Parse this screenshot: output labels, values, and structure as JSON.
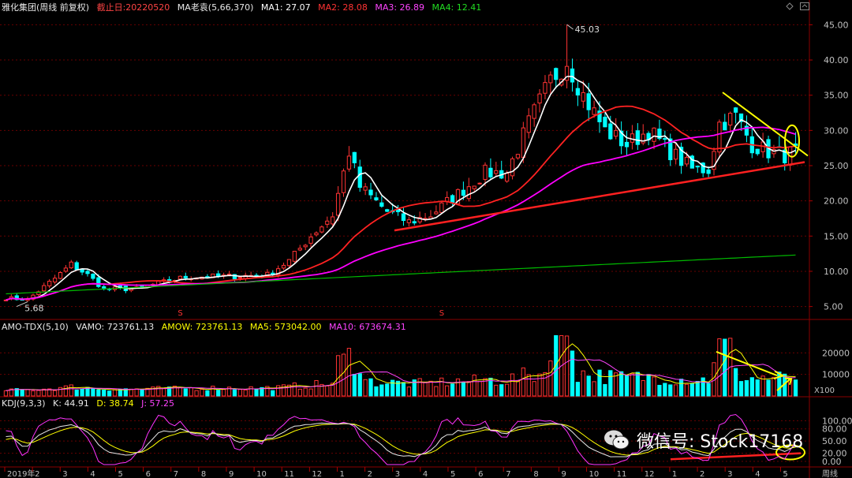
{
  "colors": {
    "bg": "#000000",
    "up": "#ff3333",
    "down": "#00ffff",
    "ma1": "#ffffff",
    "ma2": "#ff2222",
    "ma3": "#ff00ff",
    "ma4": "#00bb00",
    "trend_red": "#ff2020",
    "trend_yellow": "#ffff00",
    "grid": "#6a0000",
    "axis_text": "#c0c0c0"
  },
  "header_price": {
    "title": "雅化集团(周线 前复权)",
    "date_label": "截止日:20220520",
    "ma_name": "MA老袁(5,66,370)",
    "ma1": "MA1: 27.07",
    "ma2": "MA2: 28.08",
    "ma3": "MA3: 26.89",
    "ma4": "MA4: 12.41"
  },
  "header_volume": {
    "name": "AMO-TDX(5,10)",
    "vamo": "VAMO: 723761.13",
    "amow": "AMOW: 723761.13",
    "ma5": "MA5: 573042.00",
    "ma10": "MA10: 673674.31",
    "unit": "X100"
  },
  "header_kdj": {
    "name": "KDJ(9,3,3)",
    "k": "K: 44.91",
    "d": "D: 38.74",
    "j": "J: 57.25"
  },
  "price_high_label": "45.03",
  "price_low_label": "5.68",
  "marker_symbol": "S",
  "period_label": "周线",
  "watermark": "微信号: Stock17168",
  "chart_data": {
    "type": "candlestick",
    "price_axis": {
      "ticks": [
        45,
        40,
        35,
        30,
        25,
        20,
        15,
        10,
        5
      ],
      "labels": [
        "45.00",
        "40.00",
        "35.00",
        "30.00",
        "25.00",
        "20.00",
        "15.00",
        "10.00",
        "5.00"
      ],
      "ylim": [
        3.5,
        46.5
      ]
    },
    "volume_axis": {
      "ticks": [
        20000,
        10000
      ],
      "labels": [
        "20000",
        "10000"
      ],
      "ylim": [
        0,
        30000
      ]
    },
    "kdj_axis": {
      "ticks": [
        100,
        80,
        50,
        20,
        0
      ],
      "labels": [
        "100.00",
        "80.00",
        "50.00",
        "20.00",
        "0.00"
      ],
      "ylim": [
        -10,
        130
      ]
    },
    "x_labels": [
      "2019年",
      "2",
      "3",
      "4",
      "5",
      "6",
      "7",
      "8",
      "9",
      "10",
      "11",
      "12",
      "1",
      "2",
      "3",
      "4",
      "5",
      "6",
      "7",
      "8",
      "9",
      "10",
      "11",
      "12",
      "1",
      "2",
      "3",
      "4",
      "5"
    ],
    "anchors": [
      [
        0,
        6.2
      ],
      [
        4,
        6.0
      ],
      [
        9,
        9.0
      ],
      [
        12,
        11
      ],
      [
        15,
        9.5
      ],
      [
        18,
        7.5
      ],
      [
        24,
        7.5
      ],
      [
        28,
        8.3
      ],
      [
        33,
        9.2
      ],
      [
        42,
        9.3
      ],
      [
        48,
        9.5
      ],
      [
        52,
        11.5
      ],
      [
        56,
        15
      ],
      [
        60,
        18
      ],
      [
        63,
        27
      ],
      [
        65,
        22
      ],
      [
        70,
        18.5
      ],
      [
        74,
        17
      ],
      [
        78,
        18
      ],
      [
        83,
        21
      ],
      [
        88,
        24
      ],
      [
        92,
        24
      ],
      [
        96,
        31
      ],
      [
        100,
        37
      ],
      [
        103,
        40
      ],
      [
        106,
        35
      ],
      [
        110,
        30
      ],
      [
        114,
        28
      ],
      [
        118,
        30
      ],
      [
        122,
        27
      ],
      [
        126,
        24.5
      ],
      [
        129,
        24.5
      ],
      [
        131,
        31
      ],
      [
        134,
        32
      ],
      [
        137,
        28
      ],
      [
        140,
        27
      ],
      [
        143,
        26.5
      ],
      [
        145,
        27
      ]
    ],
    "high": 45.03,
    "low": 5.68,
    "bars": 146
  }
}
